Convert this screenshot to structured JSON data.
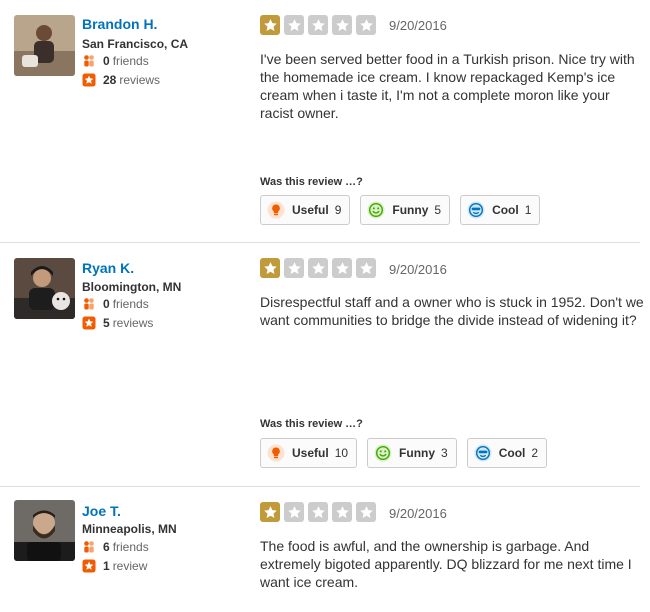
{
  "reviews": [
    {
      "user": {
        "name": "Brandon H.",
        "location": "San Francisco, CA",
        "friends_count": "0",
        "friends_label": "friends",
        "reviews_count": "28",
        "reviews_label": "reviews"
      },
      "rating": 1,
      "date": "9/20/2016",
      "text": "I've been served better food in a Turkish prison. Nice try with the homemade ice cream. I know repackaged Kemp's ice cream when i taste it, I'm not a complete moron like your racist owner.",
      "vote_question": "Was this review …?",
      "votes": [
        {
          "label": "Useful",
          "count": "9",
          "icon": "useful-bulb-icon"
        },
        {
          "label": "Funny",
          "count": "5",
          "icon": "funny-smile-icon"
        },
        {
          "label": "Cool",
          "count": "1",
          "icon": "cool-sunglasses-icon"
        }
      ]
    },
    {
      "user": {
        "name": "Ryan K.",
        "location": "Bloomington, MN",
        "friends_count": "0",
        "friends_label": "friends",
        "reviews_count": "5",
        "reviews_label": "reviews"
      },
      "rating": 1,
      "date": "9/20/2016",
      "text": "Disrespectful staff and a owner who is stuck in 1952.  Don't we want communities to bridge the divide instead of widening it?",
      "vote_question": "Was this review …?",
      "votes": [
        {
          "label": "Useful",
          "count": "10",
          "icon": "useful-bulb-icon"
        },
        {
          "label": "Funny",
          "count": "3",
          "icon": "funny-smile-icon"
        },
        {
          "label": "Cool",
          "count": "2",
          "icon": "cool-sunglasses-icon"
        }
      ]
    },
    {
      "user": {
        "name": "Joe T.",
        "location": "Minneapolis, MN",
        "friends_count": "6",
        "friends_label": "friends",
        "reviews_count": "1",
        "reviews_label": "review"
      },
      "rating": 1,
      "date": "9/20/2016",
      "text": "The food is awful, and the ownership is garbage.  And extremely bigoted apparently.  DQ blizzard for me next time I want ice cream."
    }
  ],
  "colors": {
    "link": "#0073bb",
    "star_on": "#c19a3c",
    "star_off": "#cccccc",
    "friends_icon": "#f15c00",
    "reviews_icon": "#f15c00"
  }
}
